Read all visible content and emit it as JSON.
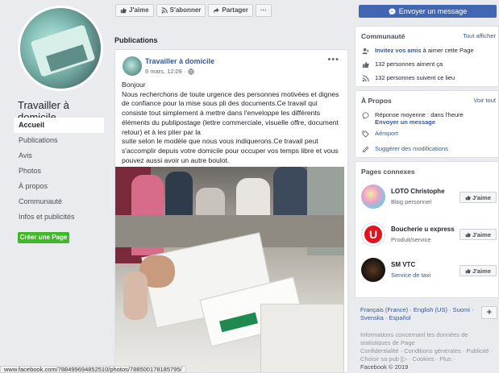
{
  "page": {
    "name": "Travailler à domicile",
    "create_page_label": "Créer une Page"
  },
  "nav": [
    {
      "label": "Accueil"
    },
    {
      "label": "Publications"
    },
    {
      "label": "Avis"
    },
    {
      "label": "Photos"
    },
    {
      "label": "À propos"
    },
    {
      "label": "Communauté"
    },
    {
      "label": "Infos et publicités"
    }
  ],
  "actions": {
    "like": "J'aime",
    "follow": "S'abonner",
    "share": "Partager",
    "more": "···"
  },
  "message_button": "Envoyer un message",
  "publications": {
    "title": "Publications",
    "post": {
      "author": "Travailler à domicile",
      "date": "9 mars, 12:09 ·",
      "more": "•••",
      "lines": [
        "Bonjour",
        "Nous recherchons de toute urgence des personnes motivées et dignes de confiance pour la mise sous pli des documents.Ce travail qui consiste tout simplement à mettre dans l'enveloppe les différents éléments du publipostage (lettre commerciale, visuelle offre, document retour) et à les plier par la",
        "suite selon le modèle que nous vous indiquerons.Ce travail peut s'accomplir depuis votre domicile pour occuper vos temps libre et vous pouvez aussi avoir un autre boulot."
      ]
    }
  },
  "community": {
    "title": "Communauté",
    "link": "Tout afficher",
    "invite_bold": "Invitez vos amis",
    "invite_rest": " à aimer cette Page",
    "likes": "132 personnes aiment ça",
    "follows": "132 personnes suivent ce lieu"
  },
  "about": {
    "title": "À Propos",
    "link": "Voir tout",
    "response_prefix": "Réponse moyenne : dans l'heure",
    "send_message": "Envoyer un message",
    "airport": "Aéroport",
    "suggest": "Suggérer des modifications"
  },
  "related": {
    "title": "Pages connexes",
    "like_label": "J'aime",
    "pages": [
      {
        "name": "LOTO Christophe",
        "category": "Blog personnel",
        "category_color": "#606770"
      },
      {
        "name": "Boucherie u express",
        "category": "Produit/service",
        "category_color": "#606770"
      },
      {
        "name": "SM VTC",
        "category": "Service de taxi",
        "category_color": "#365899"
      }
    ]
  },
  "languages": {
    "text": "Français (France) · English (US) · Suomi · Svenska · Español",
    "plus": "+"
  },
  "footer": {
    "text": "Informations concernant les données de statistiques de Page",
    "links": "Confidentialité · Conditions générales · Publicité · Choisir sa pub [▷ · Cookies · Plus ·",
    "copyright": "Facebook © 2019"
  },
  "status_url": "www.facebook.com/788499694852510/photos/788500178185795/",
  "colors": {
    "facebook_blue": "#4267b2",
    "link_blue": "#365899",
    "green": "#42b72a"
  }
}
